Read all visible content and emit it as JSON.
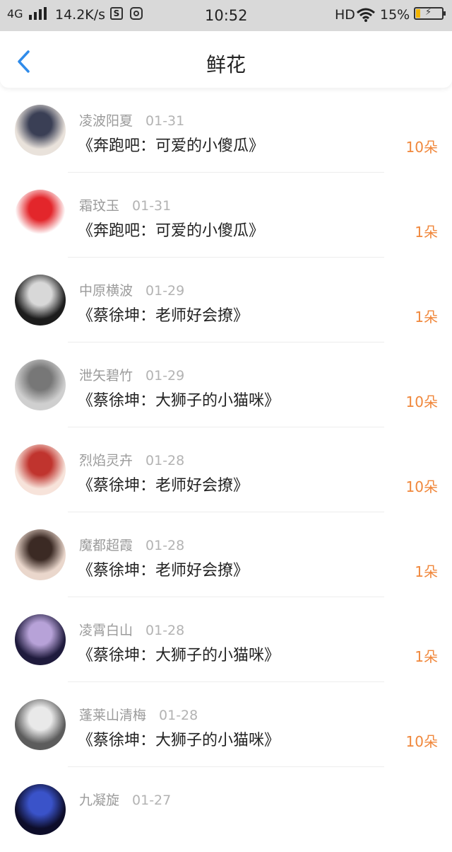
{
  "status_bar": {
    "network": "4G",
    "speed": "14.2K/s",
    "s_icon": "S",
    "time": "10:52",
    "hd": "HD",
    "battery": "15%"
  },
  "nav": {
    "title": "鲜花"
  },
  "items": [
    {
      "name": "凌波阳夏",
      "date": "01-31",
      "work": "《奔跑吧：可爱的小傻瓜》",
      "count": "10朵",
      "avatar_colors": [
        "#e9e2db",
        "#3a3f55"
      ]
    },
    {
      "name": "霜玟玉",
      "date": "01-31",
      "work": "《奔跑吧：可爱的小傻瓜》",
      "count": "1朵",
      "avatar_colors": [
        "#ffffff",
        "#e3262b"
      ]
    },
    {
      "name": "中原横波",
      "date": "01-29",
      "work": "《蔡徐坤：老师好会撩》",
      "count": "1朵",
      "avatar_colors": [
        "#1c1c1c",
        "#d8d8d8"
      ]
    },
    {
      "name": "泄矢碧竹",
      "date": "01-29",
      "work": "《蔡徐坤：大狮子的小猫咪》",
      "count": "10朵",
      "avatar_colors": [
        "#cfcfcf",
        "#777777"
      ]
    },
    {
      "name": "烈焰灵卉",
      "date": "01-28",
      "work": "《蔡徐坤：老师好会撩》",
      "count": "10朵",
      "avatar_colors": [
        "#f7e3da",
        "#c0342e"
      ]
    },
    {
      "name": "魔都超霞",
      "date": "01-28",
      "work": "《蔡徐坤：老师好会撩》",
      "count": "1朵",
      "avatar_colors": [
        "#ead7cc",
        "#3b2a24"
      ]
    },
    {
      "name": "凌霄白山",
      "date": "01-28",
      "work": "《蔡徐坤：大狮子的小猫咪》",
      "count": "1朵",
      "avatar_colors": [
        "#1f1b3d",
        "#b7a2d8"
      ]
    },
    {
      "name": "蓬莱山清梅",
      "date": "01-28",
      "work": "《蔡徐坤：大狮子的小猫咪》",
      "count": "10朵",
      "avatar_colors": [
        "#5c5c5c",
        "#e9e9e9"
      ]
    },
    {
      "name": "九凝旋",
      "date": "01-27",
      "work": "",
      "count": "",
      "avatar_colors": [
        "#0d0d2a",
        "#3a53c9"
      ]
    }
  ],
  "colors": {
    "accent_blue": "#2f8bea",
    "count_orange": "#f0873b",
    "battery_yellow": "#f2b400"
  },
  "icons": {
    "back": "chevron-left-icon",
    "wifi": "wifi-icon",
    "signal": "signal-bars-icon",
    "battery": "battery-charging-icon"
  }
}
